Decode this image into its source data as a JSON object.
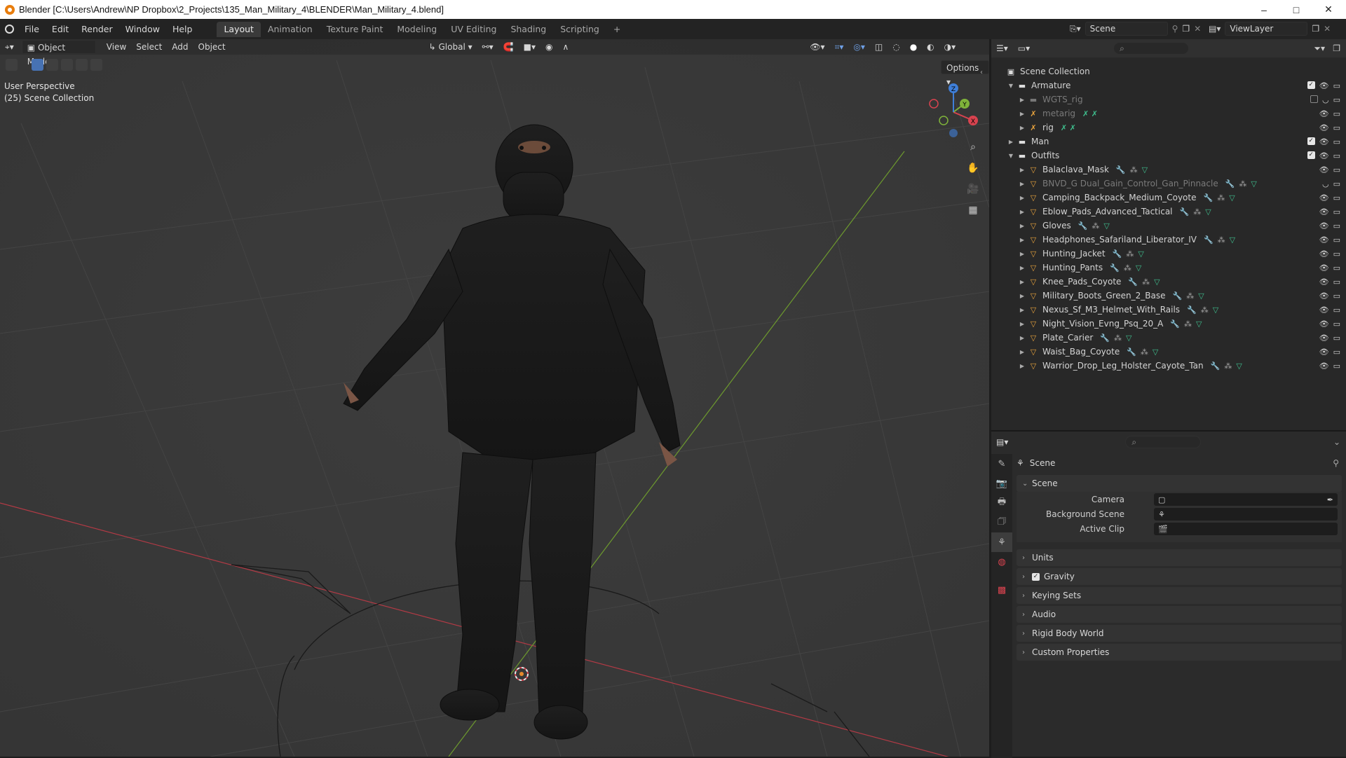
{
  "titlebar": {
    "title": "Blender [C:\\Users\\Andrew\\NP Dropbox\\2_Projects\\135_Man_Military_4\\BLENDER\\Man_Military_4.blend]",
    "min": "–",
    "max": "□",
    "close": "✕"
  },
  "menu": {
    "items": [
      "File",
      "Edit",
      "Render",
      "Window",
      "Help"
    ]
  },
  "workspaces": {
    "tabs": [
      "Layout",
      "Animation",
      "Texture Paint",
      "Modeling",
      "UV Editing",
      "Shading",
      "Scripting"
    ],
    "add": "+",
    "active": "Layout"
  },
  "scene_selector": {
    "label": "Scene"
  },
  "viewlayer_selector": {
    "label": "ViewLayer"
  },
  "viewport": {
    "mode": "Object Mode",
    "menus": [
      "View",
      "Select",
      "Add",
      "Object"
    ],
    "transform_orientation": "Global",
    "options": "Options",
    "perspective": "User Perspective",
    "collection": "(25) Scene Collection",
    "gizmo": {
      "x": "X",
      "y": "Y",
      "z": "Z"
    }
  },
  "outliner": {
    "root": "Scene Collection",
    "rows": [
      {
        "label": "Armature",
        "type": "collection",
        "level": 1,
        "expanded": true,
        "check": true
      },
      {
        "label": "WGTS_rig",
        "type": "collection-dim",
        "level": 2,
        "expanded": false,
        "check": false,
        "dim": true
      },
      {
        "label": "metarig",
        "type": "armature",
        "level": 2,
        "expanded": false,
        "dim": true
      },
      {
        "label": "rig",
        "type": "armature",
        "level": 2,
        "expanded": false
      },
      {
        "label": "Man",
        "type": "collection",
        "level": 1,
        "expanded": false,
        "check": true
      },
      {
        "label": "Outfits",
        "type": "collection",
        "level": 1,
        "expanded": true,
        "check": true
      },
      {
        "label": "Balaclava_Mask",
        "type": "mesh",
        "level": 2
      },
      {
        "label": "BNVD_G Dual_Gain_Control_Gan_Pinnacle",
        "type": "mesh",
        "level": 2,
        "dim": true
      },
      {
        "label": "Camping_Backpack_Medium_Coyote",
        "type": "mesh",
        "level": 2
      },
      {
        "label": "Eblow_Pads_Advanced_Tactical",
        "type": "mesh",
        "level": 2
      },
      {
        "label": "Gloves",
        "type": "mesh",
        "level": 2
      },
      {
        "label": "Headphones_Safariland_Liberator_IV",
        "type": "mesh",
        "level": 2
      },
      {
        "label": "Hunting_Jacket",
        "type": "mesh",
        "level": 2
      },
      {
        "label": "Hunting_Pants",
        "type": "mesh",
        "level": 2
      },
      {
        "label": "Knee_Pads_Coyote",
        "type": "mesh",
        "level": 2
      },
      {
        "label": "Military_Boots_Green_2_Base",
        "type": "mesh",
        "level": 2
      },
      {
        "label": "Nexus_Sf_M3_Helmet_With_Rails",
        "type": "mesh",
        "level": 2
      },
      {
        "label": "Night_Vision_Evng_Psq_20_A",
        "type": "mesh",
        "level": 2
      },
      {
        "label": "Plate_Carier",
        "type": "mesh",
        "level": 2
      },
      {
        "label": "Waist_Bag_Coyote",
        "type": "mesh",
        "level": 2
      },
      {
        "label": "Warrior_Drop_Leg_Holster_Cayote_Tan",
        "type": "mesh",
        "level": 2
      }
    ]
  },
  "properties": {
    "context": "Scene",
    "panel_scene": "Scene",
    "fields": [
      {
        "label": "Camera",
        "value": ""
      },
      {
        "label": "Background Scene",
        "value": ""
      },
      {
        "label": "Active Clip",
        "value": ""
      }
    ],
    "panels": [
      "Units",
      "Gravity",
      "Keying Sets",
      "Audio",
      "Rigid Body World",
      "Custom Properties"
    ],
    "gravity_checked": true
  },
  "colors": {
    "accent": "#4772b3",
    "collection": "#3fbf8e",
    "mesh": "#e8a33d",
    "axis_x": "#d9434f",
    "axis_y": "#7fb33a",
    "axis_z": "#3f7fd9"
  }
}
